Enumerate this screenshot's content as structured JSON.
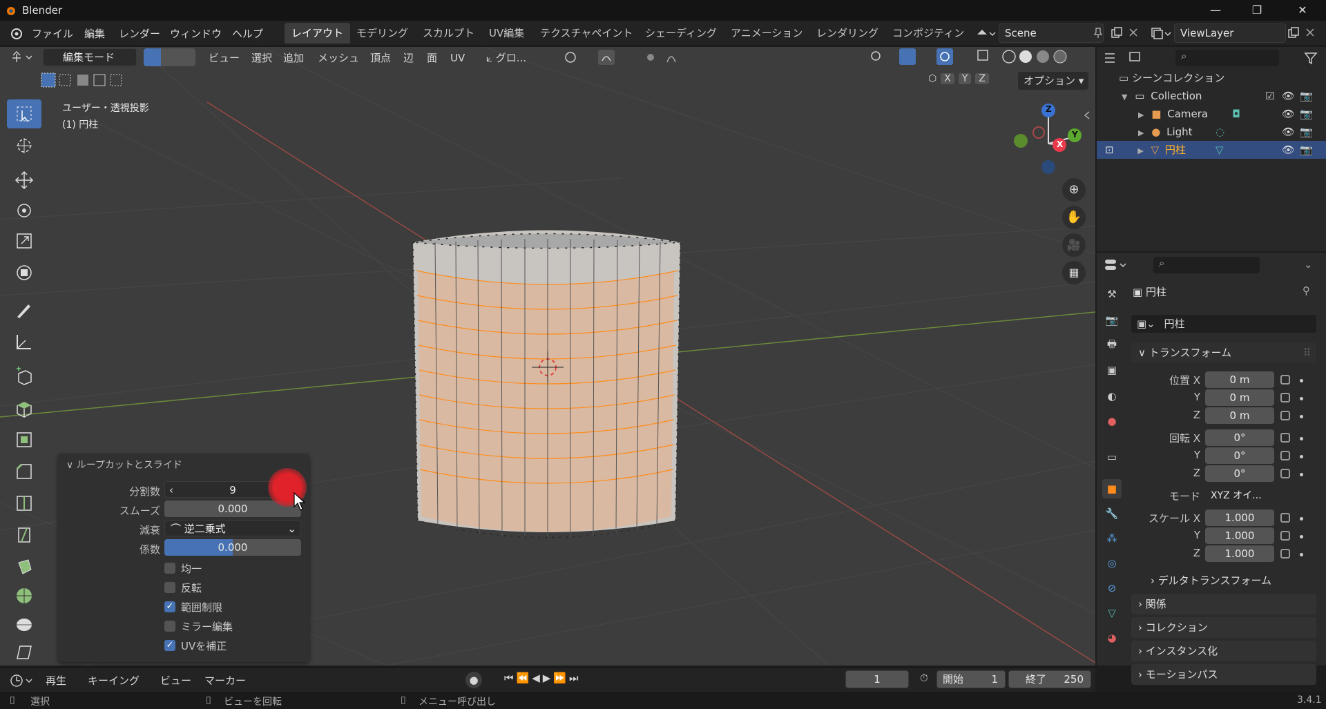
{
  "app": {
    "title": "Blender",
    "version": "3.4.1"
  },
  "menu": [
    "ファイル",
    "編集",
    "レンダー",
    "ウィンドウ",
    "ヘルプ"
  ],
  "workspaces": [
    "レイアウト",
    "モデリング",
    "スカルプト",
    "UV編集",
    "テクスチャペイント",
    "シェーディング",
    "アニメーション",
    "レンダリング",
    "コンポジティン"
  ],
  "scene": "Scene",
  "view_layer": "ViewLayer",
  "header": {
    "mode": "編集モード",
    "items": [
      "ビュー",
      "選択",
      "追加",
      "メッシュ",
      "頂点",
      "辺",
      "面",
      "UV"
    ],
    "orientation": "グロ...",
    "axes": [
      "X",
      "Y",
      "Z"
    ],
    "options": "オプション"
  },
  "viewport": {
    "projection": "ユーザー・透視投影",
    "object": "(1) 円柱",
    "gizmo_axes": [
      "Z",
      "Y",
      "X"
    ]
  },
  "operator_panel": {
    "title": "ループカットとスライド",
    "fields": [
      {
        "label": "分割数",
        "value": "9"
      },
      {
        "label": "スムーズ",
        "value": "0.000"
      },
      {
        "label": "減衰",
        "value": "逆二乗式"
      },
      {
        "label": "係数",
        "value": "0.000"
      }
    ],
    "checkboxes": [
      {
        "label": "均一",
        "checked": false
      },
      {
        "label": "反転",
        "checked": false
      },
      {
        "label": "範囲制限",
        "checked": true
      },
      {
        "label": "ミラー編集",
        "checked": false
      },
      {
        "label": "UVを補正",
        "checked": true
      }
    ]
  },
  "outliner": {
    "root": "シーンコレクション",
    "items": [
      {
        "name": "Collection",
        "level": 0
      },
      {
        "name": "Camera",
        "level": 1
      },
      {
        "name": "Light",
        "level": 1
      },
      {
        "name": "円柱",
        "level": 1,
        "selected": true
      }
    ]
  },
  "properties": {
    "object_name": "円柱",
    "data_name": "円柱",
    "transform_title": "トランスフォーム",
    "location": {
      "label": "位置 X",
      "x": "0 m",
      "y": "0 m",
      "z": "0 m"
    },
    "rotation": {
      "label": "回転 X",
      "x": "0°",
      "y": "0°",
      "z": "0°"
    },
    "mode_label": "モード",
    "mode": "XYZ オイ...",
    "scale": {
      "label": "スケール X",
      "x": "1.000",
      "y": "1.000",
      "z": "1.000"
    },
    "axis_y": "Y",
    "axis_z": "Z",
    "delta": "デルタトランスフォーム",
    "sections": [
      "関係",
      "コレクション",
      "インスタンス化",
      "モーションパス"
    ]
  },
  "timeline": {
    "playback": "再生",
    "keying": "キーイング",
    "view": "ビュー",
    "marker": "マーカー",
    "frame": "1",
    "start_label": "開始",
    "start": "1",
    "end_label": "終了",
    "end": "250"
  },
  "status": {
    "left": "選択",
    "middle": "ビューを回転",
    "right": "メニュー呼び出し"
  },
  "colors": {
    "accent": "#4772b3",
    "selected_orange": "#ff8c1a"
  }
}
